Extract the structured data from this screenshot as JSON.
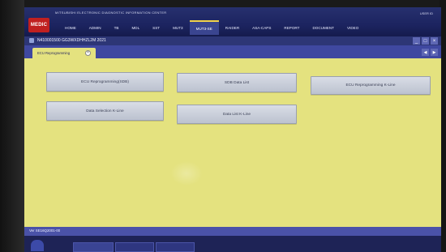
{
  "header": {
    "app_title": "MITSUBISHI ELECTRONIC DIAGNOSTIC INFORMATION CENTER",
    "logo_text": "MEDIC",
    "user_info": "USER ID",
    "nav_items": [
      {
        "label": "HOME"
      },
      {
        "label": "ADMIN"
      },
      {
        "label": "TB"
      },
      {
        "label": "MDL"
      },
      {
        "label": "SST"
      },
      {
        "label": "MUT3"
      },
      {
        "label": "MUT3-SE"
      },
      {
        "label": "RAIDER"
      },
      {
        "label": "ASA-CAPS"
      },
      {
        "label": "REPORT"
      },
      {
        "label": "DOCUMENT"
      },
      {
        "label": "VIDEO"
      }
    ],
    "active_nav": "MUT3-SE"
  },
  "vehicle_bar": {
    "text": "N410001500  GG3WXDHHZL2M 2021"
  },
  "tabs": [
    {
      "label": "ECU Reprogramming",
      "close": "×"
    }
  ],
  "window_controls": [
    "_",
    "□",
    "×"
  ],
  "tab_scroll": [
    "◀",
    "▶"
  ],
  "main": {
    "buttons": [
      {
        "label": "ECU Reprogramming(SDB)"
      },
      {
        "label": "SDB Data List"
      },
      {
        "label": "ECU Reprogramming K-Line"
      },
      {
        "label": "Data Selection K-Line"
      },
      {
        "label": "Data List K-Line"
      }
    ]
  },
  "status": {
    "version": "Ver SE16Q2001-00"
  },
  "colors": {
    "content_bg": "#e4e27f",
    "header_bg": "#1c2460",
    "tab_bar": "#3f48a0",
    "button_bg": "#c9ced9"
  }
}
